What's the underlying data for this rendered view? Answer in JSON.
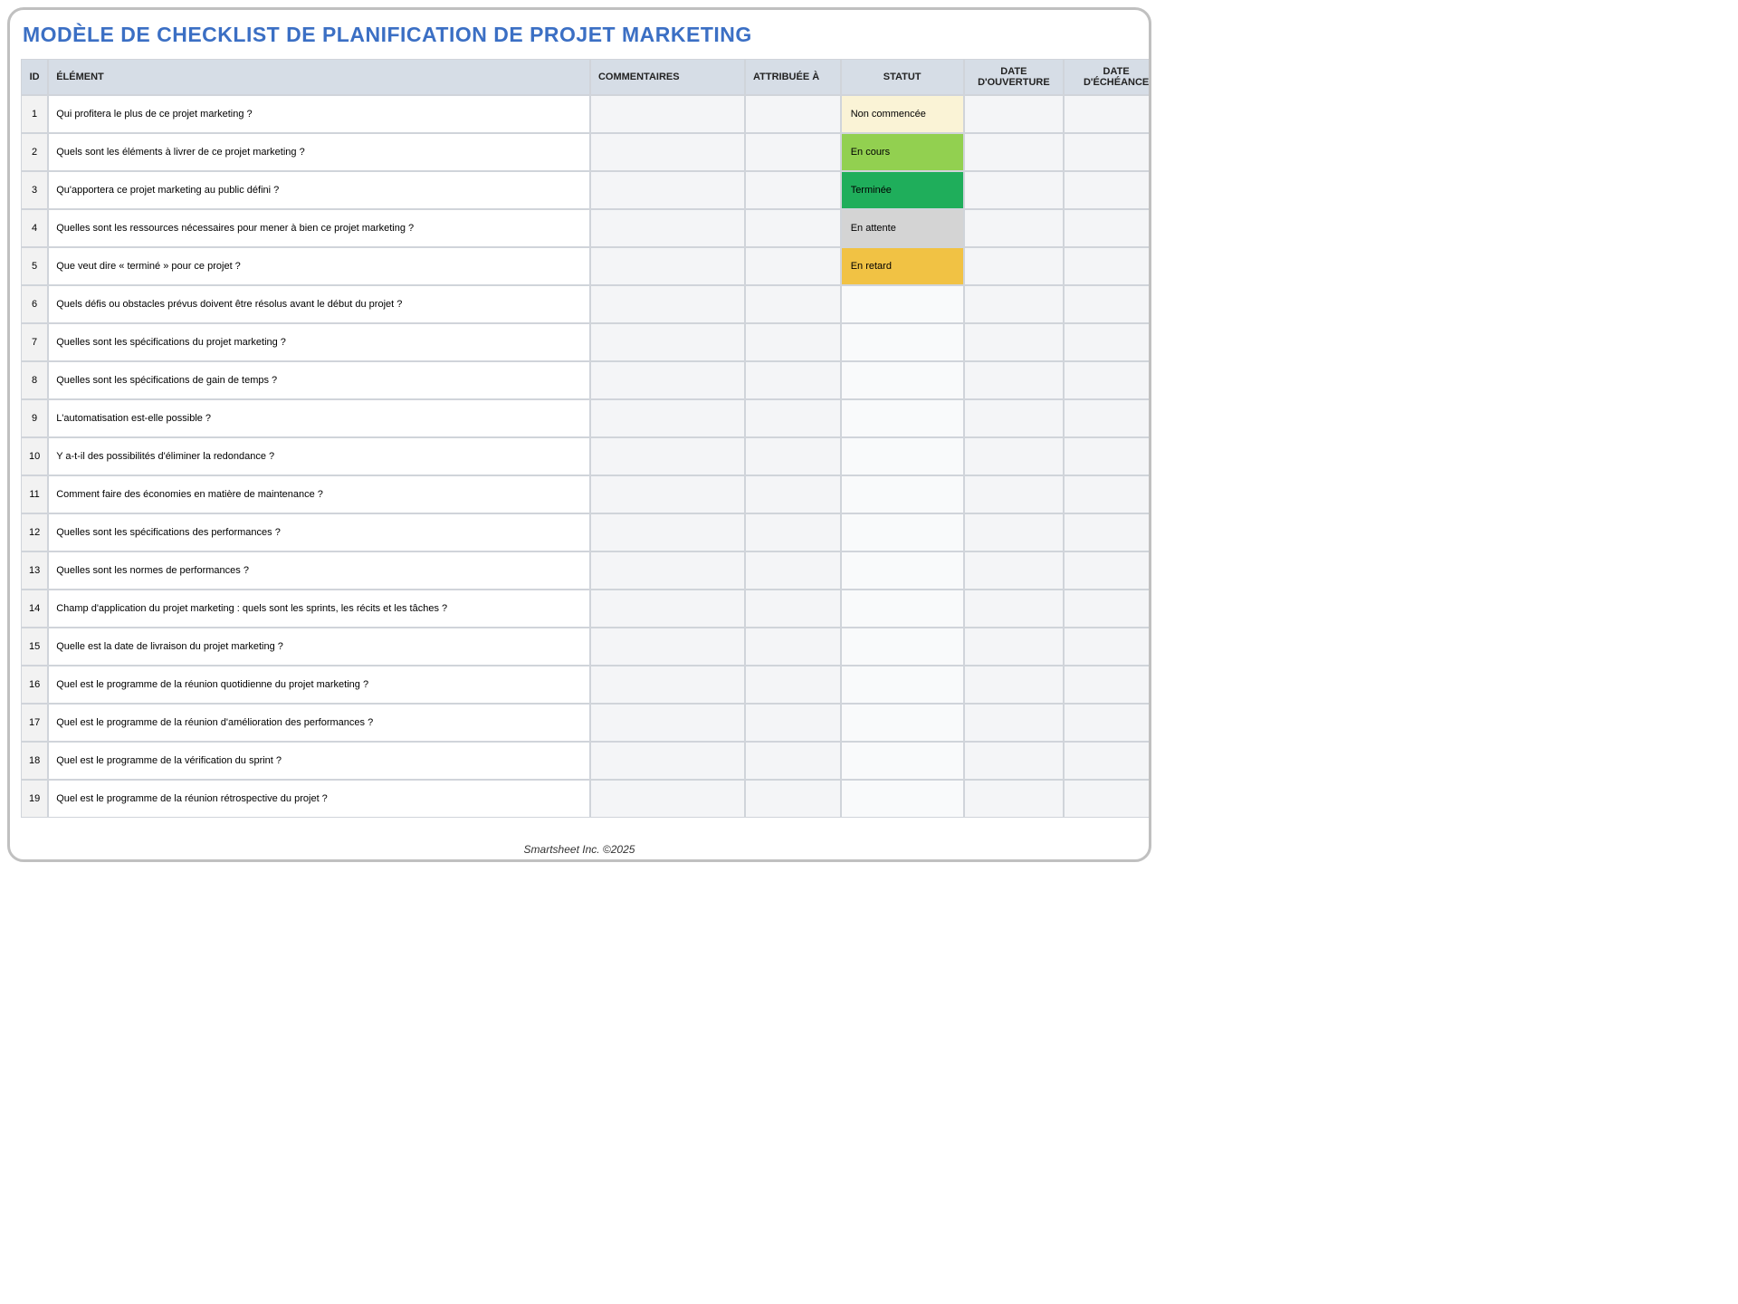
{
  "title": "MODÈLE DE CHECKLIST DE PLANIFICATION DE PROJET MARKETING",
  "columns": {
    "id": "ID",
    "element": "ÉLÉMENT",
    "comments": "COMMENTAIRES",
    "assigned": "ATTRIBUÉE À",
    "status": "STATUT",
    "openDate": "DATE D'OUVERTURE",
    "dueDate": "DATE D'ÉCHÉANCE"
  },
  "statusStyles": {
    "Non commencée": "s-not",
    "En cours": "s-prog",
    "Terminée": "s-done",
    "En attente": "s-hold",
    "En retard": "s-late"
  },
  "rows": [
    {
      "id": "1",
      "element": "Qui profitera le plus de ce projet marketing ?",
      "status": "Non commencée"
    },
    {
      "id": "2",
      "element": "Quels sont les éléments à livrer de ce projet marketing ?",
      "status": "En cours"
    },
    {
      "id": "3",
      "element": "Qu'apportera ce projet marketing au public défini ?",
      "status": "Terminée"
    },
    {
      "id": "4",
      "element": "Quelles sont les ressources nécessaires pour mener à bien ce projet marketing ?",
      "status": "En attente"
    },
    {
      "id": "5",
      "element": "Que veut dire « terminé » pour ce projet ?",
      "status": "En retard"
    },
    {
      "id": "6",
      "element": "Quels défis ou obstacles prévus doivent être résolus avant le début du projet ?",
      "status": ""
    },
    {
      "id": "7",
      "element": "Quelles sont les spécifications du projet marketing ?",
      "status": ""
    },
    {
      "id": "8",
      "element": "Quelles sont les spécifications de gain de temps ?",
      "status": ""
    },
    {
      "id": "9",
      "element": "L'automatisation est-elle possible ?",
      "status": ""
    },
    {
      "id": "10",
      "element": "Y a-t-il des possibilités d'éliminer la redondance ?",
      "status": ""
    },
    {
      "id": "11",
      "element": "Comment faire des économies en matière de maintenance ?",
      "status": ""
    },
    {
      "id": "12",
      "element": "Quelles sont les spécifications des performances ?",
      "status": ""
    },
    {
      "id": "13",
      "element": "Quelles sont les normes de performances ?",
      "status": ""
    },
    {
      "id": "14",
      "element": "Champ d'application du projet marketing  : quels sont les sprints, les récits et les tâches ?",
      "status": ""
    },
    {
      "id": "15",
      "element": "Quelle est la date de livraison du projet marketing ?",
      "status": ""
    },
    {
      "id": "16",
      "element": "Quel est le programme de la réunion quotidienne du projet marketing ?",
      "status": ""
    },
    {
      "id": "17",
      "element": "Quel est le programme de la réunion d'amélioration des performances ?",
      "status": ""
    },
    {
      "id": "18",
      "element": "Quel est le programme de la vérification du sprint ?",
      "status": ""
    },
    {
      "id": "19",
      "element": "Quel est le programme de la réunion rétrospective du projet ?",
      "status": ""
    }
  ],
  "footer": "Smartsheet Inc. ©2025"
}
